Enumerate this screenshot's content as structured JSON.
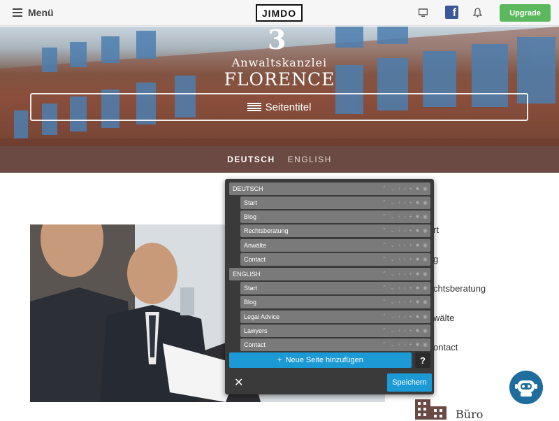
{
  "topbar": {
    "menu_label": "Menü",
    "logo_text": "JIMDO",
    "upgrade_label": "Upgrade",
    "icons": [
      "monitor-icon",
      "facebook-icon",
      "bell-icon"
    ],
    "facebook_letter": "f",
    "colors": {
      "upgrade": "#5cb85c",
      "facebook": "#3b5998"
    }
  },
  "hero": {
    "mark": "3",
    "subtitle": "Anwaltskanzlei",
    "title": "FLORENCE",
    "page_title_placeholder": "Seitentitel"
  },
  "langbar": {
    "items": [
      {
        "label": "DEUTSCH",
        "active": true
      },
      {
        "label": "ENGLISH",
        "active": false
      }
    ],
    "color": "#6b4a43"
  },
  "side_nav": {
    "items": [
      "rt",
      "g",
      "chtsberatung",
      "wälte",
      "ontact"
    ],
    "buero": "Büro"
  },
  "nav_editor": {
    "sections": [
      {
        "label": "DEUTSCH",
        "pages": [
          "Start",
          "Blog",
          "Rechtsberatung",
          "Anwälte",
          "Contact"
        ]
      },
      {
        "label": "ENGLISH",
        "pages": [
          "Start",
          "Blog",
          "Legal Advice",
          "Lawyers",
          "Contact"
        ]
      }
    ],
    "add_page_label": "Neue Seite hinzufügen",
    "help_label": "?",
    "close_label": "✕",
    "save_label": "Speichern",
    "accent": "#1c9ad6"
  }
}
